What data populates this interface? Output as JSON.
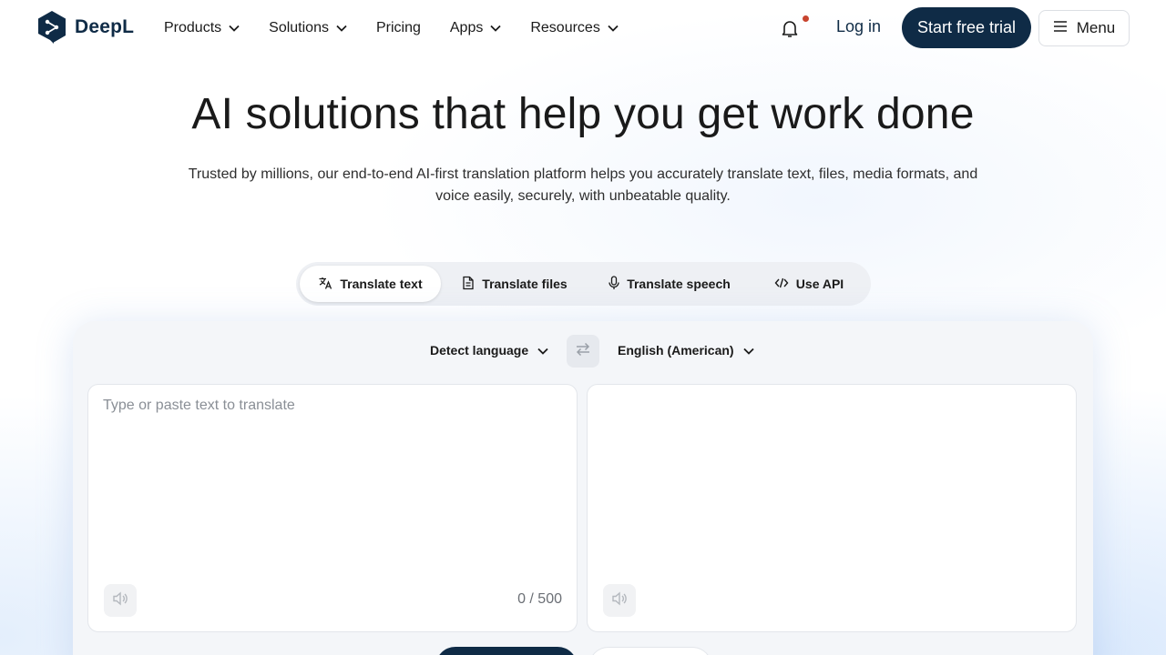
{
  "brand": {
    "name": "DeepL"
  },
  "nav": {
    "items": [
      {
        "label": "Products",
        "has_dropdown": true
      },
      {
        "label": "Solutions",
        "has_dropdown": true
      },
      {
        "label": "Pricing",
        "has_dropdown": false
      },
      {
        "label": "Apps",
        "has_dropdown": true
      },
      {
        "label": "Resources",
        "has_dropdown": true
      }
    ],
    "login_label": "Log in",
    "trial_label": "Start free trial",
    "menu_label": "Menu"
  },
  "hero": {
    "title": "AI solutions that help you get work done",
    "subtitle": "Trusted by millions, our end-to-end AI-first translation platform helps you accurately translate text, files, media formats, and voice easily, securely, with unbeatable quality."
  },
  "tabs": [
    {
      "label": "Translate text",
      "icon": "translate-icon",
      "active": true
    },
    {
      "label": "Translate files",
      "icon": "document-icon",
      "active": false
    },
    {
      "label": "Translate speech",
      "icon": "microphone-icon",
      "active": false
    },
    {
      "label": "Use API",
      "icon": "code-icon",
      "active": false
    }
  ],
  "translator": {
    "source_language": "Detect language",
    "target_language": "English (American)",
    "source_placeholder": "Type or paste text to translate",
    "source_value": "",
    "char_counter": "0 / 500"
  },
  "colors": {
    "brand_navy": "#0f2b46",
    "notification_dot": "#c8442f",
    "card_bg": "#f4f6f9"
  }
}
